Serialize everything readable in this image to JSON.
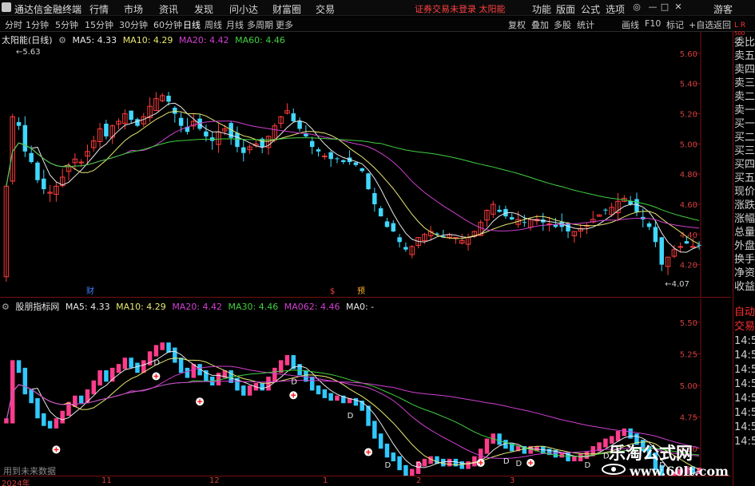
{
  "titlebar": {
    "app_name": "通达信金融终端",
    "menu": [
      "行情",
      "市场",
      "资讯",
      "发现",
      "问小达",
      "财富圈",
      "交易"
    ],
    "status": "证券交易未登录  太阳能",
    "controls": [
      "功能",
      "版面",
      "公式",
      "选项"
    ],
    "guest": "游客"
  },
  "tabbar": {
    "tabs": [
      "分时",
      "1分钟",
      "5分钟",
      "15分钟",
      "30分钟",
      "60分钟",
      "日线",
      "周线",
      "月线",
      "多周期",
      "更多"
    ],
    "active_tab": "日线",
    "right_tabs": [
      "复权",
      "叠加",
      "多股",
      "统计",
      "画线",
      "F10",
      "标记",
      "+自选",
      "返回"
    ]
  },
  "main_chart": {
    "legend": {
      "name": "太阳能(日线)",
      "items": [
        {
          "label": "MA5: 4.33",
          "color": "#e8e8e8"
        },
        {
          "label": "MA10: 4.29",
          "color": "#e8e870"
        },
        {
          "label": "MA20: 4.42",
          "color": "#d040d0"
        },
        {
          "label": "MA60: 4.46",
          "color": "#40d040"
        }
      ]
    },
    "y_ticks": [
      "5.60",
      "5.40",
      "5.20",
      "5.00",
      "4.80",
      "4.60",
      "4.40",
      "4.20"
    ],
    "high_label": "5.63",
    "low_label": "4.07",
    "markers": [
      "财",
      "$",
      "预"
    ]
  },
  "sub_chart": {
    "legend": {
      "name": "股朋指标网",
      "items": [
        {
          "label": "MA5: 4.33",
          "color": "#e8e8e8"
        },
        {
          "label": "MA10: 4.29",
          "color": "#e8e870"
        },
        {
          "label": "MA20: 4.42",
          "color": "#d040d0"
        },
        {
          "label": "MA30: 4.46",
          "color": "#40d040"
        },
        {
          "label": "MA062: 4.46",
          "color": "#d040d0"
        },
        {
          "label": "MA0: -",
          "color": "#e8e8e8"
        }
      ]
    },
    "y_ticks": [
      "5.50",
      "5.25",
      "5.00",
      "4.75",
      "4.50"
    ],
    "signal_letter": "D",
    "hint": "用到未来数据"
  },
  "date_axis": [
    "2024年",
    "11",
    "12",
    "1",
    "2",
    "3"
  ],
  "right_panel": {
    "top": [
      "L",
      "R",
      "500"
    ],
    "main_items": [
      "委比",
      "卖五",
      "卖四",
      "卖三",
      "卖二",
      "卖一",
      "买一",
      "买二",
      "买三",
      "买四",
      "买五",
      "现价",
      "涨跌",
      "涨幅",
      "总量",
      "外盘",
      "换手",
      "净资",
      "收益"
    ],
    "sub_items": [
      "自动",
      "交易",
      "14:56",
      "14:56",
      "14:56",
      "14:56",
      "14:56",
      "14:56",
      "14:56",
      "14:56"
    ]
  },
  "watermark": {
    "title": "乐淘公式网",
    "url": "www.60lt.com"
  },
  "chart_data": {
    "type": "candlestick",
    "title": "太阳能(日线)",
    "ylim": [
      4.07,
      5.63
    ],
    "ma": {
      "MA5": 4.33,
      "MA10": 4.29,
      "MA20": 4.42,
      "MA60": 4.46
    },
    "x_labels": [
      "2024年",
      "11",
      "12",
      "1",
      "2",
      "3"
    ],
    "close": [
      4.72,
      5.18,
      5.12,
      4.95,
      4.88,
      4.76,
      4.7,
      4.68,
      4.72,
      4.78,
      4.85,
      4.9,
      4.88,
      4.95,
      5.02,
      5.1,
      5.05,
      5.12,
      5.15,
      5.2,
      5.16,
      5.12,
      5.18,
      5.25,
      5.3,
      5.32,
      5.28,
      5.2,
      5.12,
      5.08,
      5.15,
      5.1,
      5.05,
      5.02,
      5.08,
      5.1,
      5.04,
      4.98,
      4.94,
      4.98,
      5.0,
      4.98,
      5.05,
      5.12,
      5.18,
      5.22,
      5.15,
      5.1,
      5.05,
      4.98,
      4.95,
      4.92,
      4.9,
      4.9,
      4.88,
      4.88,
      4.86,
      4.82,
      4.7,
      4.6,
      4.52,
      4.45,
      4.42,
      4.35,
      4.3,
      4.32,
      4.38,
      4.4,
      4.42,
      4.4,
      4.38,
      4.4,
      4.38,
      4.36,
      4.38,
      4.42,
      4.48,
      4.56,
      4.6,
      4.55,
      4.52,
      4.5,
      4.5,
      4.48,
      4.5,
      4.5,
      4.48,
      4.47,
      4.45,
      4.45,
      4.42,
      4.42,
      4.44,
      4.46,
      4.5,
      4.53,
      4.56,
      4.58,
      4.62,
      4.64,
      4.6,
      4.55,
      4.5,
      4.45,
      4.35,
      4.2,
      4.25,
      4.3,
      4.32,
      4.34,
      4.32,
      4.33
    ]
  }
}
